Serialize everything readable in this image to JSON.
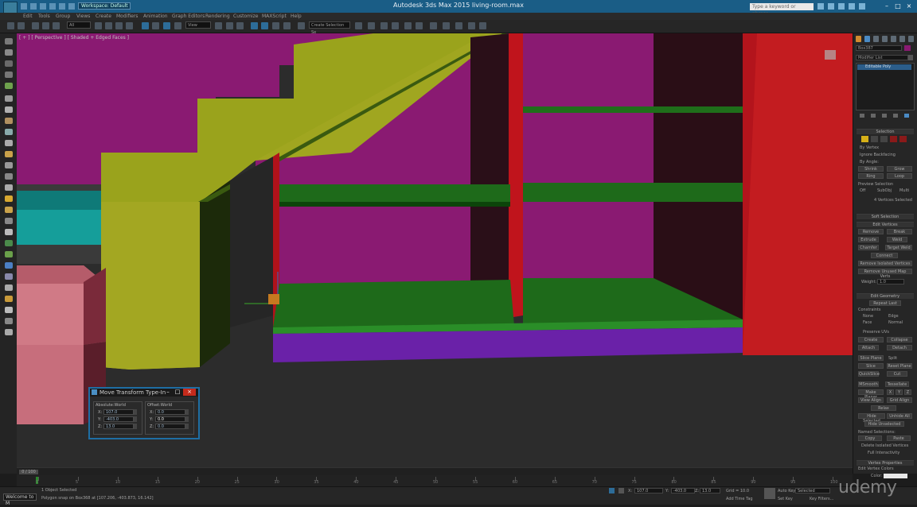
{
  "window": {
    "title": "Autodesk 3ds Max  2015    living-room.max",
    "workspace": "Workspace: Default",
    "search_placeholder": "Type a keyword or phrase"
  },
  "menu": [
    "Edit",
    "Tools",
    "Group",
    "Views",
    "Create",
    "Modifiers",
    "Animation",
    "Graph Editors",
    "Rendering",
    "Customize",
    "MAXScript",
    "Help"
  ],
  "toolbar": {
    "filter_dropdown": "All",
    "view_dropdown": "View",
    "selection_set": "Create Selection Se"
  },
  "viewport": {
    "label": "[ + ] [ Perspective ] [ Shaded + Edged Faces ]"
  },
  "move_transform": {
    "title": "Move Transform Type-In",
    "absolute_label": "Absolute:World",
    "offset_label": "Offset:World",
    "absolute": [
      {
        "axis": "X:",
        "value": "107.0"
      },
      {
        "axis": "Y:",
        "value": "-403.0"
      },
      {
        "axis": "Z:",
        "value": "13.0"
      }
    ],
    "offset": [
      {
        "axis": "X:",
        "value": "0.0"
      },
      {
        "axis": "Y:",
        "value": "0.0"
      },
      {
        "axis": "Z:",
        "value": "0.0"
      }
    ]
  },
  "command_panel": {
    "object_name": "Box387",
    "modifier_list": "Modifier List",
    "stack_item": "Editable Poly",
    "selection": {
      "header": "Selection",
      "by_vertex": "By Vertex",
      "ignore_backfacing": "Ignore Backfacing",
      "by_angle": "By Angle:",
      "shrink": "Shrink",
      "grow": "Grow",
      "ring": "Ring",
      "loop": "Loop",
      "preview_selection": "Preview Selection",
      "off": "Off",
      "subobj": "SubObj",
      "multi": "Multi",
      "status": "4 Vertices Selected"
    },
    "soft_selection": "Soft Selection",
    "edit_vertices": {
      "header": "Edit Vertices",
      "remove": "Remove",
      "break": "Break",
      "extrude": "Extrude",
      "weld": "Weld",
      "chamfer": "Chamfer",
      "target_weld": "Target Weld",
      "connect": "Connect",
      "remove_isolated": "Remove Isolated Vertices",
      "remove_unused": "Remove Unused Map Verts",
      "weight_label": "Weight:",
      "weight_value": "1.0"
    },
    "edit_geometry": {
      "header": "Edit Geometry",
      "repeat_last": "Repeat Last",
      "constraints": "Constraints",
      "none": "None",
      "edge": "Edge",
      "face": "Face",
      "normal": "Normal",
      "preserve_uvs": "Preserve UVs",
      "create": "Create",
      "collapse": "Collapse",
      "attach": "Attach",
      "detach": "Detach",
      "slice_plane": "Slice Plane",
      "split": "Split",
      "slice": "Slice",
      "reset_plane": "Reset Plane",
      "quickslice": "QuickSlice",
      "cut": "Cut",
      "msmooth": "MSmooth",
      "tessellate": "Tessellate",
      "make_planar": "Make Planar",
      "x": "X",
      "y": "Y",
      "z": "Z",
      "view_align": "View Align",
      "grid_align": "Grid Align",
      "relax": "Relax",
      "hide_selected": "Hide Selected",
      "unhide_all": "Unhide All",
      "hide_unselected": "Hide Unselected",
      "named_selections": "Named Selections:",
      "copy": "Copy",
      "paste": "Paste",
      "delete_isolated": "Delete Isolated Vertices",
      "full_interactivity": "Full Interactivity"
    },
    "vertex_properties": {
      "header": "Vertex Properties",
      "edit_vertex_colors": "Edit Vertex Colors",
      "color": "Color:"
    }
  },
  "timeline": {
    "frame": "0 / 100",
    "ticks": [
      "0",
      "5",
      "10",
      "15",
      "20",
      "25",
      "30",
      "35",
      "40",
      "45",
      "50",
      "55",
      "60",
      "65",
      "70",
      "75",
      "80",
      "85",
      "90",
      "95",
      "100"
    ]
  },
  "status": {
    "welcome": "Welcome to M",
    "line1": "1 Object Selected",
    "line2": "Polygon snap on Box368 at [107.206, -403.873, 16.142]",
    "x_label": "X:",
    "x_value": "107.0",
    "y_label": "Y:",
    "y_value": "-403.0",
    "z_label": "Z:",
    "z_value": "13.0",
    "grid": "Grid = 10.0",
    "add_time_tag": "Add Time Tag",
    "auto_key": "Auto Key",
    "set_key": "Set Key",
    "selected": "Selected",
    "key_filters": "Key Filters..."
  },
  "watermark": "udemy"
}
